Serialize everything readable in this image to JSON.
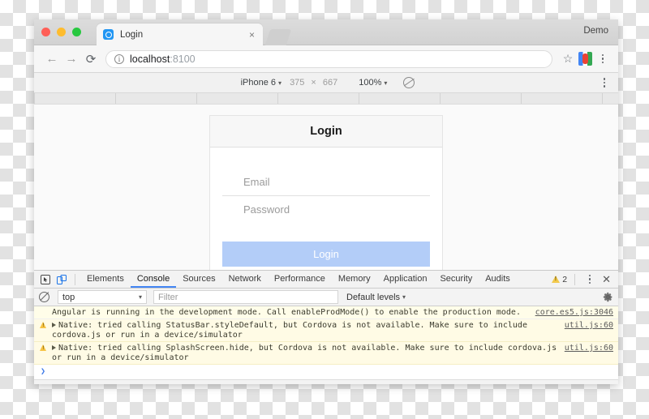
{
  "browser": {
    "window_label": "Demo",
    "tab": {
      "title": "Login",
      "close_label": "×",
      "favicon_name": "app-favicon"
    },
    "toolbar": {
      "back_label": "←",
      "forward_label": "→",
      "reload_label": "⟳",
      "info_label": "i",
      "url_host": "localhost",
      "url_port": ":8100",
      "star_label": "☆"
    }
  },
  "device_bar": {
    "device": "iPhone 6",
    "width": "375",
    "times": "×",
    "height": "667",
    "zoom": "100%",
    "caret": "▾",
    "throttle_name": "throttling-icon"
  },
  "page": {
    "card_title": "Login",
    "fields": [
      {
        "name": "email-field",
        "placeholder": "Email"
      },
      {
        "name": "password-field",
        "placeholder": "Password"
      }
    ],
    "submit_label": "Login",
    "submit_color": "#b3cdf8"
  },
  "devtools": {
    "tabs": [
      {
        "label": "Elements",
        "active": false
      },
      {
        "label": "Console",
        "active": true
      },
      {
        "label": "Sources",
        "active": false
      },
      {
        "label": "Network",
        "active": false
      },
      {
        "label": "Performance",
        "active": false
      },
      {
        "label": "Memory",
        "active": false
      },
      {
        "label": "Application",
        "active": false
      },
      {
        "label": "Security",
        "active": false
      },
      {
        "label": "Audits",
        "active": false
      }
    ],
    "warning_count": "2",
    "close_label": "✕",
    "console_toolbar": {
      "clear_name": "clear-console-icon",
      "context": "top",
      "context_caret": "▾",
      "filter_placeholder": "Filter",
      "levels": "Default levels",
      "levels_caret": "▾",
      "settings_name": "settings-gear-icon"
    },
    "messages": [
      {
        "level": "info",
        "expandable": false,
        "text": "Angular is running in the development mode. Call enableProdMode() to enable the production mode.",
        "link": "core.es5.js:3046"
      },
      {
        "level": "warn",
        "expandable": true,
        "text": "Native: tried calling StatusBar.styleDefault, but Cordova is not available. Make sure to include cordova.js or run in a device/simulator",
        "link": "util.js:60"
      },
      {
        "level": "warn",
        "expandable": true,
        "text": "Native: tried calling SplashScreen.hide, but Cordova is not available. Make sure to include cordova.js or run in a device/simulator",
        "link": "util.js:60"
      }
    ],
    "prompt": "❯"
  }
}
